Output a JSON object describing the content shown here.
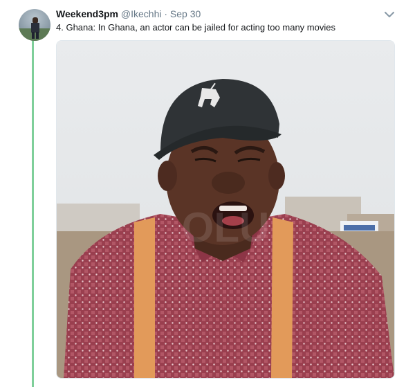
{
  "tweet": {
    "display_name": "Weekend3pm",
    "handle": "@Ikechhi",
    "separator": "·",
    "timestamp": "Sep 30",
    "text": "4. Ghana: In Ghana, an actor can be jailed for acting too many movies",
    "menu_icon": "chevron-down-icon",
    "avatar_icon": "user-avatar",
    "media_watermark": "OLU"
  },
  "colors": {
    "thread_line": "#7fcf9a",
    "name": "#14171a",
    "muted": "#657786"
  }
}
